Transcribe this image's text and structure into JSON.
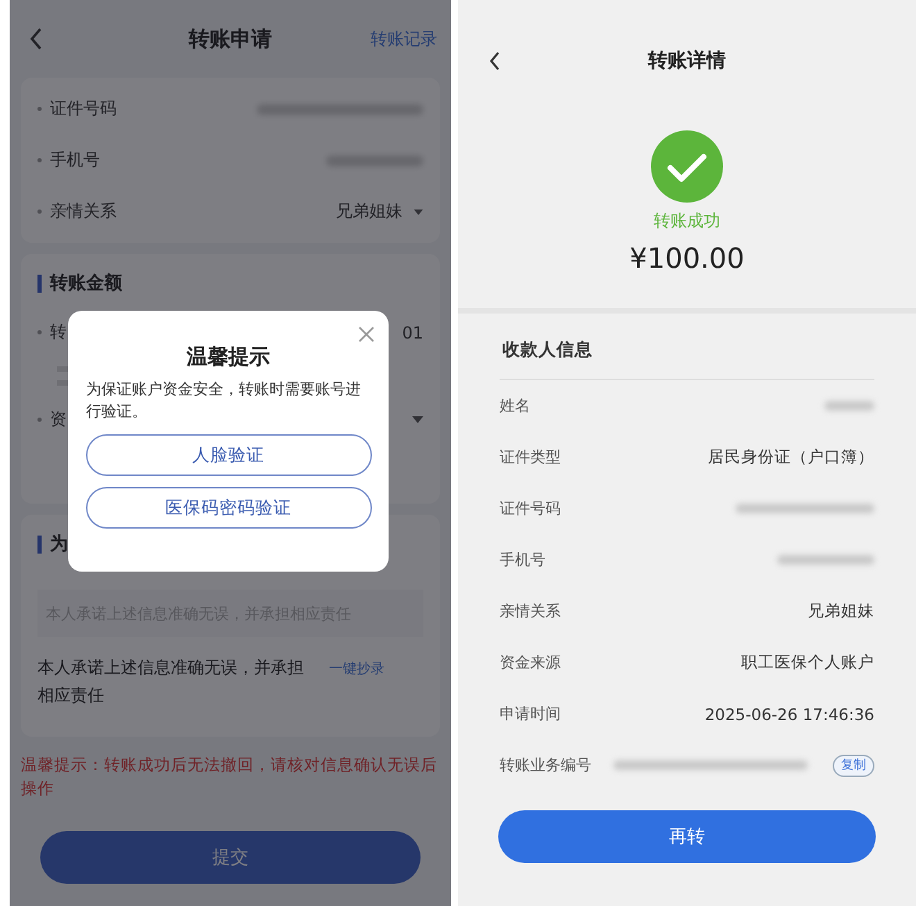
{
  "apply_screen": {
    "title": "转账申请",
    "records_link": "转账记录",
    "identity_rows": [
      {
        "label": "证件号码",
        "required": true,
        "kind": "redacted"
      },
      {
        "label": "手机号",
        "required": true,
        "kind": "redacted"
      },
      {
        "label": "亲情关系",
        "required": true,
        "kind": "select",
        "value": "兄弟姐妹"
      }
    ],
    "amount_section": {
      "title": "转账金额",
      "amount_row": {
        "label": "转",
        "value": "01",
        "required": true
      },
      "fund_row": {
        "label": "资",
        "required": true
      }
    },
    "pledge_section": {
      "title": "为",
      "placeholder": "本人承诺上述信息准确无误，并承担相应责任",
      "text": "本人承诺上述信息准确无误，并承担相应责任",
      "copy_link": "一键抄录"
    },
    "warning": "温馨提示：转账成功后无法撤回，请核对信息确认无误后操作",
    "submit": "提交",
    "dialog": {
      "title": "温馨提示",
      "message": "为保证账户资金安全，转账时需要账号进行验证。",
      "buttons": [
        "人脸验证",
        "医保码密码验证"
      ]
    }
  },
  "detail_screen": {
    "title": "转账详情",
    "status": "转账成功",
    "amount": "¥100.00",
    "section_title": "收款人信息",
    "rows": [
      {
        "label": "姓名",
        "kind": "redacted"
      },
      {
        "label": "证件类型",
        "kind": "text",
        "value": "居民身份证（户口簿）"
      },
      {
        "label": "证件号码",
        "kind": "redacted"
      },
      {
        "label": "手机号",
        "kind": "redacted"
      },
      {
        "label": "亲情关系",
        "kind": "text",
        "value": "兄弟姐妹"
      },
      {
        "label": "资金来源",
        "kind": "text",
        "value": "职工医保个人账户"
      },
      {
        "label": "申请时间",
        "kind": "text",
        "value": "2025-06-26  17:46:36"
      },
      {
        "label": "转账业务编号",
        "kind": "copy",
        "button": "复制"
      }
    ],
    "again_button": "再转"
  }
}
